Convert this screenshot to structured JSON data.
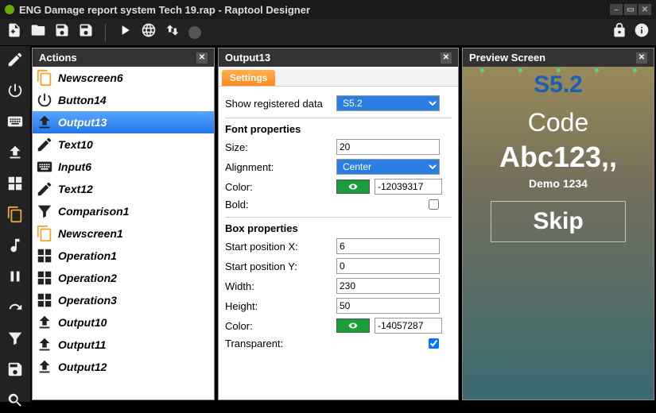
{
  "window": {
    "title": "ENG Damage report system Tech 19.rap - Raptool Designer"
  },
  "panels": {
    "actions_title": "Actions",
    "output_title": "Output13",
    "preview_title": "Preview Screen"
  },
  "actions": [
    {
      "label": "Newscreen6",
      "icon": "copy",
      "orange": true
    },
    {
      "label": "Button14",
      "icon": "power"
    },
    {
      "label": "Output13",
      "icon": "upload",
      "selected": true
    },
    {
      "label": "Text10",
      "icon": "pencil"
    },
    {
      "label": "Input6",
      "icon": "keyboard"
    },
    {
      "label": "Text12",
      "icon": "pencil"
    },
    {
      "label": "Comparison1",
      "icon": "funnel"
    },
    {
      "label": "Newscreen1",
      "icon": "copy",
      "orange": true
    },
    {
      "label": "Operation1",
      "icon": "grid"
    },
    {
      "label": "Operation2",
      "icon": "grid"
    },
    {
      "label": "Operation3",
      "icon": "grid"
    },
    {
      "label": "Output10",
      "icon": "upload"
    },
    {
      "label": "Output11",
      "icon": "upload"
    },
    {
      "label": "Output12",
      "icon": "upload"
    }
  ],
  "tab": {
    "settings": "Settings"
  },
  "form": {
    "show_registered_label": "Show registered data",
    "show_registered_value": "S5.2",
    "font_section": "Font properties",
    "size_label": "Size:",
    "size_value": "20",
    "align_label": "Alignment:",
    "align_value": "Center",
    "color_label": "Color:",
    "font_color_value": "-12039317",
    "bold_label": "Bold:",
    "box_section": "Box properties",
    "startx_label": "Start position X:",
    "startx_value": "6",
    "starty_label": "Start position Y:",
    "starty_value": "0",
    "width_label": "Width:",
    "width_value": "230",
    "height_label": "Height:",
    "height_value": "50",
    "box_color_value": "-14057287",
    "transparent_label": "Transparent:"
  },
  "preview": {
    "s52": "S5.2",
    "code": "Code",
    "abc": "Abc123,,",
    "demo": "Demo 1234",
    "skip": "Skip"
  }
}
